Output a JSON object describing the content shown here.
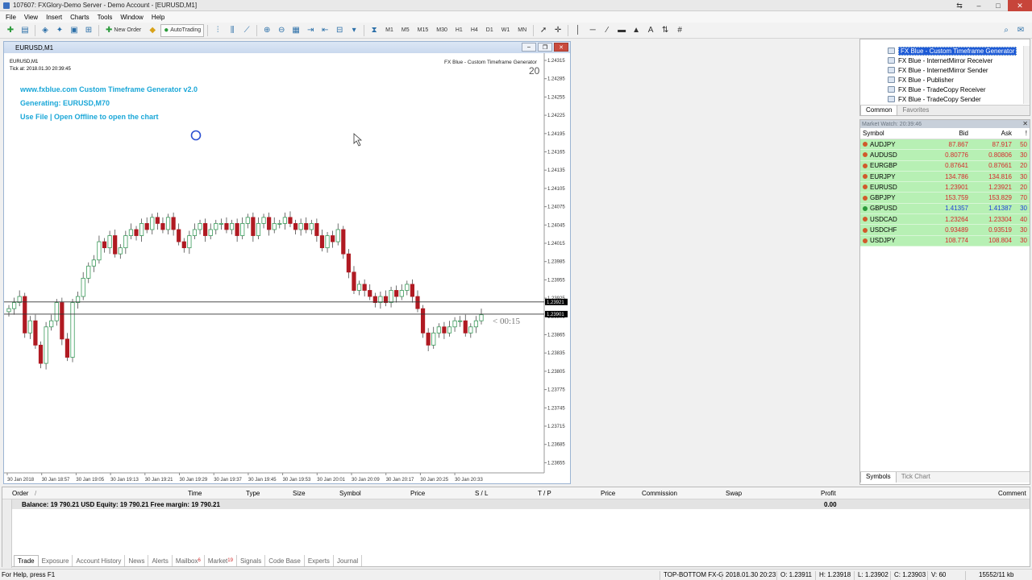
{
  "window": {
    "title": "107607: FXGlory-Demo Server - Demo Account - [EURUSD,M1]"
  },
  "menu": [
    "File",
    "View",
    "Insert",
    "Charts",
    "Tools",
    "Window",
    "Help"
  ],
  "toolbar": {
    "new_order": "New Order",
    "autotrading": "AutoTrading",
    "timeframes": [
      "M1",
      "M5",
      "M15",
      "M30",
      "H1",
      "H4",
      "D1",
      "W1",
      "MN"
    ]
  },
  "chart": {
    "window_title": "EURUSD,M1",
    "symbol_label": "EURUSD,M1",
    "tick_label": "Tick at: 2018.01.30 20:39:45",
    "indicator_label": "FX Blue - Custom Timeframe Generator",
    "indicator_value": "20",
    "info_line1": "www.fxblue.com Custom Timeframe Generator v2.0",
    "info_line2": "Generating: EURUSD,M70",
    "info_line3": "Use File | Open Offline to open the chart",
    "countdown": "< 00:15",
    "price_ticks": [
      "1.24315",
      "1.24285",
      "1.24255",
      "1.24225",
      "1.24195",
      "1.24165",
      "1.24135",
      "1.24105",
      "1.24075",
      "1.24045",
      "1.24015",
      "1.23985",
      "1.23955",
      "1.23925",
      "1.23895",
      "1.23865",
      "1.23835",
      "1.23805",
      "1.23775",
      "1.23745",
      "1.23715",
      "1.23685",
      "1.23655"
    ],
    "ask_marker": "1.23921",
    "bid_marker": "1.23901",
    "time_ticks": [
      "30 Jan 2018",
      "30 Jan 18:57",
      "30 Jan 19:05",
      "30 Jan 19:13",
      "30 Jan 19:21",
      "30 Jan 19:29",
      "30 Jan 19:37",
      "30 Jan 19:45",
      "30 Jan 19:53",
      "30 Jan 20:01",
      "30 Jan 20:09",
      "30 Jan 20:17",
      "30 Jan 20:25",
      "30 Jan 20:33"
    ],
    "colors": {
      "bull": "#3a9a5a",
      "bear": "#b01a22",
      "info_text": "#1aa7d8"
    }
  },
  "chart_data": {
    "type": "candlestick",
    "symbol": "EURUSD",
    "timeframe": "M1",
    "ylim": [
      1.2364,
      1.2433
    ],
    "closes": [
      1.2391,
      1.2392,
      1.2393,
      1.2387,
      1.2389,
      1.2385,
      1.2382,
      1.2388,
      1.2389,
      1.2392,
      1.2386,
      1.2383,
      1.2392,
      1.2393,
      1.2396,
      1.2398,
      1.2399,
      1.2402,
      1.2401,
      1.2403,
      1.24,
      1.2401,
      1.2403,
      1.2404,
      1.2403,
      1.2405,
      1.2404,
      1.2406,
      1.2405,
      1.2404,
      1.2406,
      1.2404,
      1.2402,
      1.2401,
      1.2403,
      1.2404,
      1.2405,
      1.2403,
      1.2404,
      1.2405,
      1.2405,
      1.2404,
      1.2405,
      1.2403,
      1.2405,
      1.2406,
      1.2403,
      1.2405,
      1.2406,
      1.2404,
      1.2405,
      1.2405,
      1.2406,
      1.2405,
      1.2404,
      1.2405,
      1.2404,
      1.2405,
      1.2403,
      1.2401,
      1.2403,
      1.2402,
      1.2404,
      1.24,
      1.2397,
      1.2394,
      1.2395,
      1.2394,
      1.2393,
      1.2392,
      1.2393,
      1.2392,
      1.2394,
      1.2393,
      1.2394,
      1.2395,
      1.2393,
      1.2391,
      1.2387,
      1.2385,
      1.2387,
      1.2388,
      1.2387,
      1.2388,
      1.2389,
      1.2389,
      1.2387,
      1.2388,
      1.2389,
      1.239
    ]
  },
  "navigator": {
    "items": [
      "FX Blue - Custom Timeframe Generator",
      "FX Blue - InternetMirror Receiver",
      "FX Blue - InternetMirror Sender",
      "FX Blue - Publisher",
      "FX Blue - TradeCopy Receiver",
      "FX Blue - TradeCopy Sender"
    ],
    "tabs": [
      "Common",
      "Favorites"
    ]
  },
  "market_watch": {
    "title": "Market Watch: 20:39:46",
    "columns": [
      "Symbol",
      "Bid",
      "Ask",
      "!"
    ],
    "rows": [
      {
        "symbol": "AUDJPY",
        "bid": "87.867",
        "ask": "87.917",
        "spread": "50",
        "dir": "up"
      },
      {
        "symbol": "AUDUSD",
        "bid": "0.80776",
        "ask": "0.80806",
        "spread": "30",
        "dir": "up"
      },
      {
        "symbol": "EURGBP",
        "bid": "0.87641",
        "ask": "0.87661",
        "spread": "20",
        "dir": "up"
      },
      {
        "symbol": "EURJPY",
        "bid": "134.786",
        "ask": "134.816",
        "spread": "30",
        "dir": "up"
      },
      {
        "symbol": "EURUSD",
        "bid": "1.23901",
        "ask": "1.23921",
        "spread": "20",
        "dir": "up"
      },
      {
        "symbol": "GBPJPY",
        "bid": "153.759",
        "ask": "153.829",
        "spread": "70",
        "dir": "up"
      },
      {
        "symbol": "GBPUSD",
        "bid": "1.41357",
        "ask": "1.41387",
        "spread": "30",
        "dir": "dn"
      },
      {
        "symbol": "USDCAD",
        "bid": "1.23264",
        "ask": "1.23304",
        "spread": "40",
        "dir": "up"
      },
      {
        "symbol": "USDCHF",
        "bid": "0.93489",
        "ask": "0.93519",
        "spread": "30",
        "dir": "up"
      },
      {
        "symbol": "USDJPY",
        "bid": "108.774",
        "ask": "108.804",
        "spread": "30",
        "dir": "up"
      }
    ],
    "tabs": [
      "Symbols",
      "Tick Chart"
    ]
  },
  "terminal": {
    "columns": [
      "Order",
      "Time",
      "Type",
      "Size",
      "Symbol",
      "Price",
      "S / L",
      "T / P",
      "Price",
      "Commission",
      "Swap",
      "Profit",
      "Comment"
    ],
    "sort_marker": "/",
    "balance_line": "Balance: 19 790.21 USD  Equity: 19 790.21  Free margin: 19 790.21",
    "profit_total": "0.00",
    "tabs": [
      {
        "label": "Trade",
        "badge": ""
      },
      {
        "label": "Exposure",
        "badge": ""
      },
      {
        "label": "Account History",
        "badge": ""
      },
      {
        "label": "News",
        "badge": ""
      },
      {
        "label": "Alerts",
        "badge": ""
      },
      {
        "label": "Mailbox",
        "badge": "6"
      },
      {
        "label": "Market",
        "badge": "19"
      },
      {
        "label": "Signals",
        "badge": ""
      },
      {
        "label": "Code Base",
        "badge": ""
      },
      {
        "label": "Experts",
        "badge": ""
      },
      {
        "label": "Journal",
        "badge": ""
      }
    ]
  },
  "statusbar": {
    "help": "For Help, press F1",
    "profile": "TOP-BOTTOM FX-G",
    "datetime": "2018.01.30 20:23",
    "open": "O: 1.23911",
    "high": "H: 1.23918",
    "low": "L: 1.23902",
    "close": "C: 1.23903",
    "volume": "V: 60",
    "traffic": "15552/11 kb"
  }
}
